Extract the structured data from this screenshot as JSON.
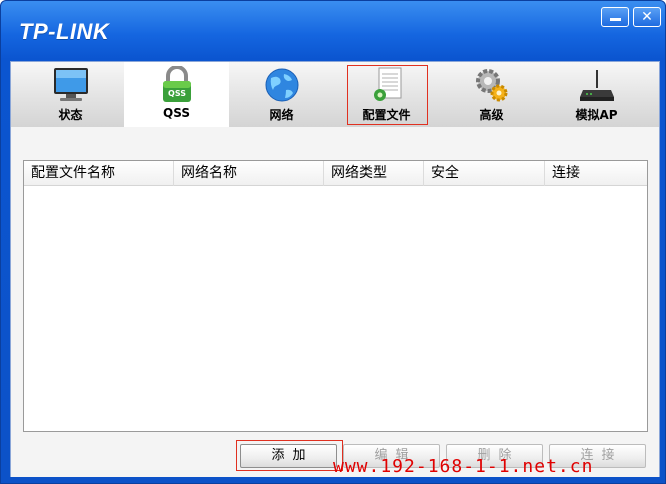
{
  "window": {
    "brand": "TP-LINK",
    "minimize_icon": "minimize-icon",
    "close_icon": "close-icon",
    "close_glyph": "✕"
  },
  "tabs": [
    {
      "label": "状态",
      "icon": "monitor-icon",
      "active": false
    },
    {
      "label": "QSS",
      "icon": "lock-icon",
      "badge": "QSS",
      "active": true
    },
    {
      "label": "网络",
      "icon": "globe-icon",
      "active": false
    },
    {
      "label": "配置文件",
      "icon": "document-icon",
      "active": false,
      "highlighted": true
    },
    {
      "label": "高级",
      "icon": "gears-icon",
      "active": false
    },
    {
      "label": "模拟AP",
      "icon": "router-icon",
      "active": false
    }
  ],
  "profile_list": {
    "columns": [
      "配置文件名称",
      "网络名称",
      "网络类型",
      "安全",
      "连接"
    ],
    "rows": []
  },
  "buttons": {
    "add": "添加",
    "edit": "编辑",
    "delete": "删除",
    "connect": "连接"
  },
  "watermark": "www.192-168-1-1.net.cn",
  "colors": {
    "title_bar": "#0c52c8",
    "highlight": "#e03020",
    "watermark": "#e00000"
  }
}
